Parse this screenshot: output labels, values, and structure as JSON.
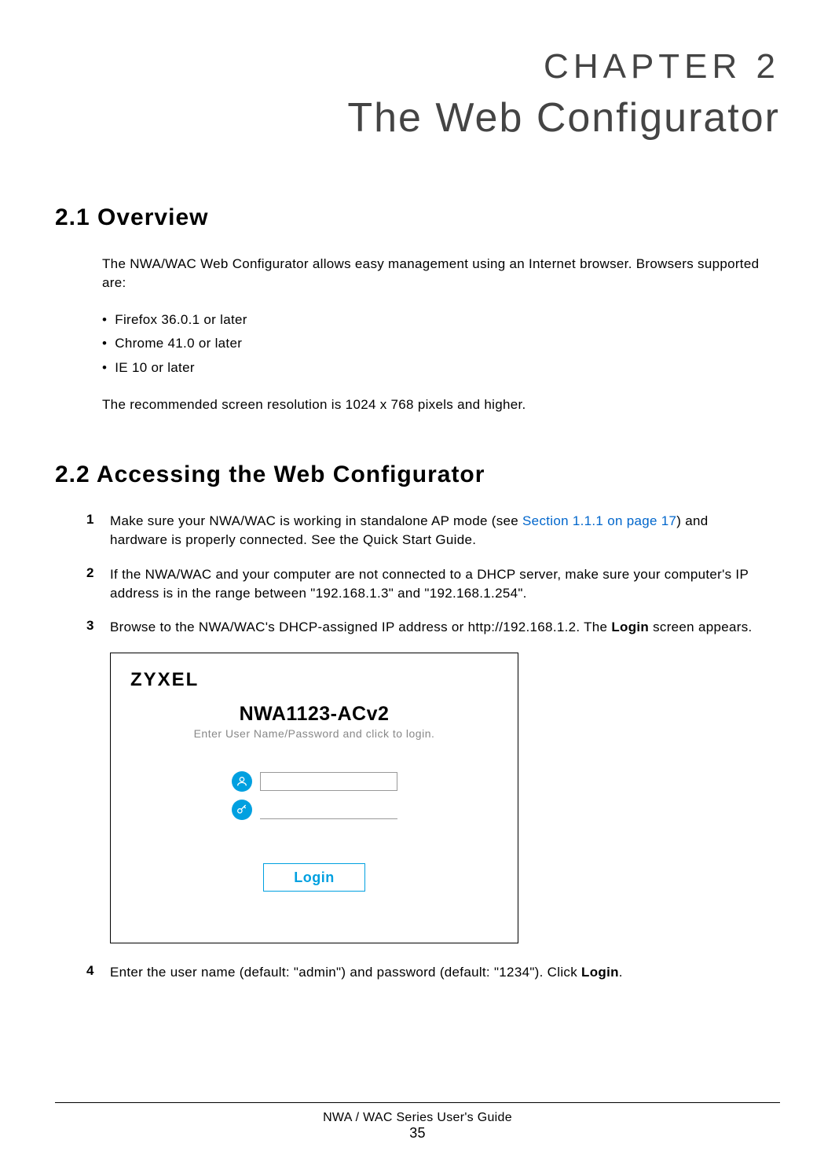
{
  "chapter": {
    "label": "CHAPTER 2",
    "title": "The Web Configurator"
  },
  "section_2_1": {
    "heading": "2.1  Overview",
    "intro": "The NWA/WAC Web Configurator allows easy management using an Internet browser. Browsers supported are:",
    "bullets": [
      "Firefox 36.0.1 or later",
      "Chrome 41.0 or later",
      "IE 10 or later"
    ],
    "resolution_note": "The recommended screen resolution is 1024 x 768 pixels and higher."
  },
  "section_2_2": {
    "heading": "2.2  Accessing the Web Configurator",
    "steps": {
      "1": {
        "num": "1",
        "pre": "Make sure your NWA/WAC is working in standalone AP mode (see ",
        "link": "Section 1.1.1 on page 17",
        "post": ") and hardware is properly connected. See the Quick Start Guide."
      },
      "2": {
        "num": "2",
        "text": "If the NWA/WAC and your computer are not connected to a DHCP server, make sure your computer's IP address is in the range between \"192.168.1.3\" and \"192.168.1.254\"."
      },
      "3": {
        "num": "3",
        "pre": "Browse to the NWA/WAC's DHCP-assigned IP address or http://192.168.1.2. The ",
        "bold": "Login",
        "post": " screen appears."
      },
      "4": {
        "num": "4",
        "pre": "Enter the user name (default: \"admin\") and password (default: \"1234\"). Click ",
        "bold": "Login",
        "post": "."
      }
    }
  },
  "login_screen": {
    "logo": "ZYXEL",
    "device": "NWA1123-ACv2",
    "hint": "Enter User Name/Password and click to login.",
    "user_value": "",
    "pass_value": "",
    "button_label": "Login"
  },
  "footer": {
    "guide": "NWA / WAC Series User's Guide",
    "page": "35"
  }
}
